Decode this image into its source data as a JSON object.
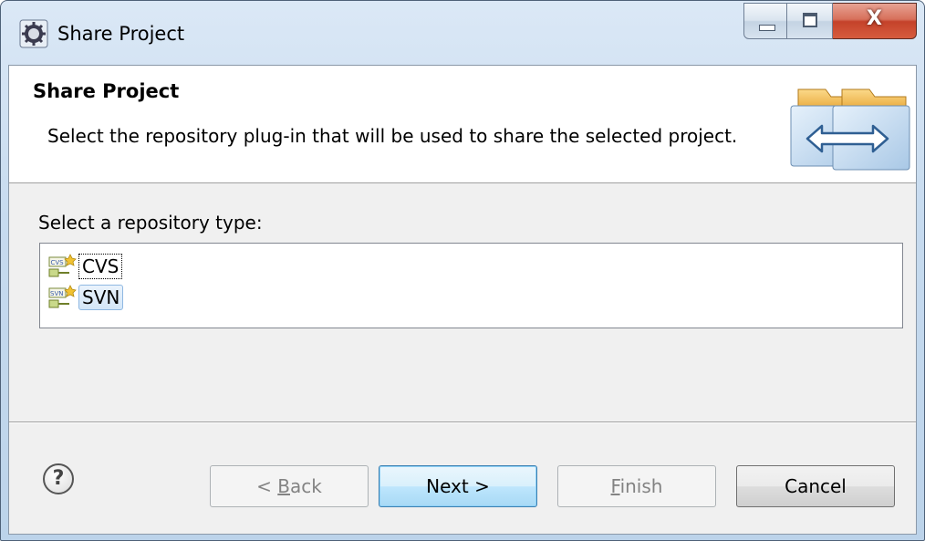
{
  "window": {
    "title": "Share Project",
    "controls": {
      "minimize": "minimize-icon",
      "maximize": "maximize-icon",
      "close": "X"
    }
  },
  "banner": {
    "title": "Share Project",
    "description": "Select the repository plug-in that will be used to share the selected project.",
    "image_icon": "share-folders-icon"
  },
  "repository": {
    "label": "Select a repository type:",
    "items": [
      {
        "label": "CVS",
        "icon": "cvs-repository-icon",
        "state": "focused"
      },
      {
        "label": "SVN",
        "icon": "svn-repository-icon",
        "state": "selected"
      }
    ]
  },
  "buttons": {
    "help": "?",
    "back": {
      "prefix": "< ",
      "mnemonic": "B",
      "rest": "ack"
    },
    "next": "Next >",
    "finish": {
      "mnemonic": "F",
      "rest": "inish"
    },
    "cancel": "Cancel"
  },
  "colors": {
    "frame": "#bcd3ea",
    "close_button": "#c4422a",
    "selection": "#d3e6f8",
    "default_button": "#bee6fd"
  }
}
